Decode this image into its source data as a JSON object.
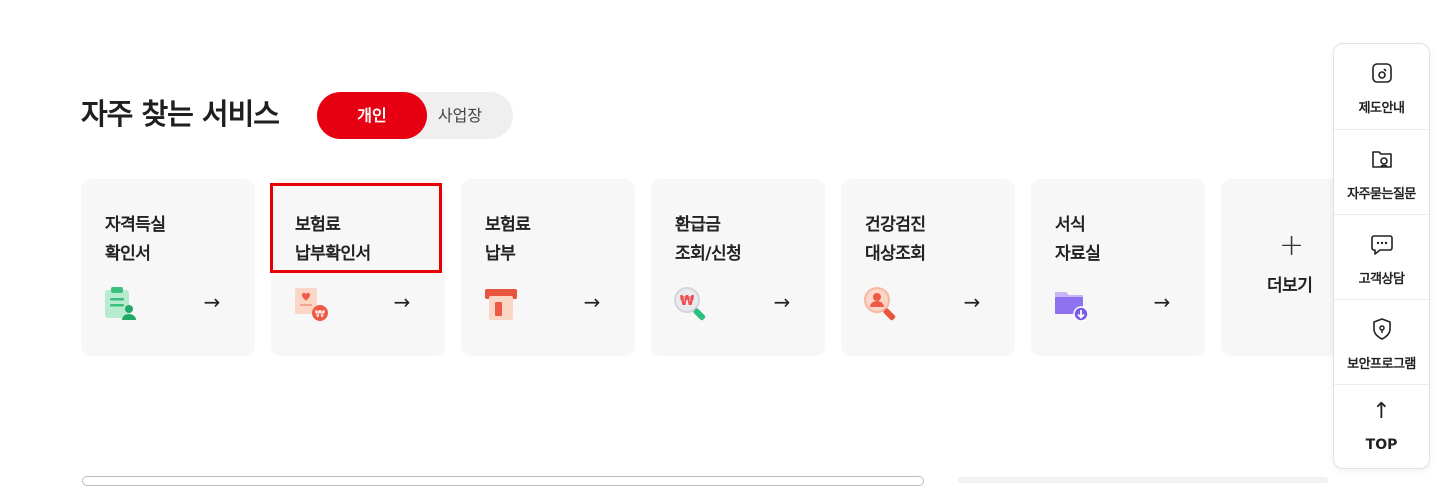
{
  "section": {
    "title": "자주 찾는 서비스"
  },
  "toggle": {
    "active_label": "개인",
    "inactive_label": "사업장"
  },
  "colors": {
    "accent": "#e60012",
    "card_bg": "#f7f7f7"
  },
  "cards": [
    {
      "line1": "자격득실",
      "line2": "확인서",
      "icon": "certificate-user-icon",
      "arrow": "→"
    },
    {
      "line1": "보험료",
      "line2": "납부확인서",
      "icon": "receipt-won-icon",
      "arrow": "→"
    },
    {
      "line1": "보험료",
      "line2": "납부",
      "icon": "card-payment-icon",
      "arrow": "→"
    },
    {
      "line1": "환급금",
      "line2": "조회/신청",
      "icon": "search-won-icon",
      "arrow": "→"
    },
    {
      "line1": "건강검진",
      "line2": "대상조회",
      "icon": "search-person-icon",
      "arrow": "→"
    },
    {
      "line1": "서식",
      "line2": "자료실",
      "icon": "folder-download-icon",
      "arrow": "→"
    }
  ],
  "more": {
    "plus": "+",
    "label": "더보기"
  },
  "quick_panel": [
    {
      "label": "제도안내",
      "icon": "document-icon"
    },
    {
      "label": "자주묻는질문",
      "icon": "folder-question-icon"
    },
    {
      "label": "고객상담",
      "icon": "chat-icon"
    },
    {
      "label": "보안프로그램",
      "icon": "shield-icon"
    }
  ],
  "top": {
    "arrow": "↑",
    "label": "TOP"
  }
}
